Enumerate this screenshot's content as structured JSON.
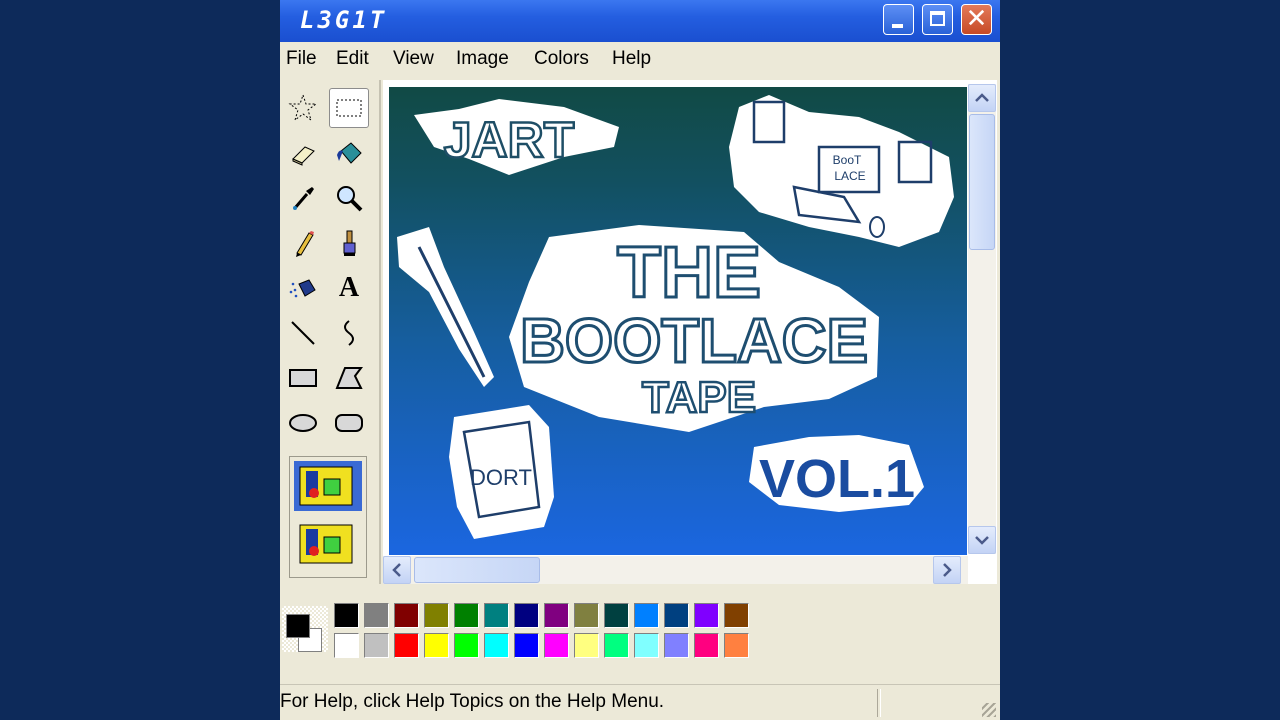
{
  "window": {
    "title": "L3G1T",
    "controls": [
      "minimize",
      "maximize",
      "close"
    ],
    "close_glyph": "✕"
  },
  "menu": {
    "items": [
      "File",
      "Edit",
      "View",
      "Image",
      "Colors",
      "Help"
    ]
  },
  "toolbox": {
    "tools": [
      {
        "name": "free-form-select-icon"
      },
      {
        "name": "rect-select-icon",
        "selected": true
      },
      {
        "name": "eraser-icon"
      },
      {
        "name": "fill-bucket-icon"
      },
      {
        "name": "color-picker-icon"
      },
      {
        "name": "magnifier-icon"
      },
      {
        "name": "pencil-icon"
      },
      {
        "name": "brush-icon"
      },
      {
        "name": "airbrush-icon"
      },
      {
        "name": "text-icon",
        "glyph": "A"
      },
      {
        "name": "line-icon"
      },
      {
        "name": "curve-icon"
      },
      {
        "name": "rectangle-icon"
      },
      {
        "name": "polygon-icon"
      },
      {
        "name": "ellipse-icon"
      },
      {
        "name": "rounded-rect-icon"
      }
    ]
  },
  "artwork": {
    "texts": [
      "JART",
      "THE",
      "BOOTLACE",
      "TAPE",
      "VOL.1",
      "DORT",
      "BooT",
      "LACE"
    ]
  },
  "palette": {
    "foreground": "#000000",
    "background": "#ffffff",
    "row1": [
      "#000000",
      "#808080",
      "#800000",
      "#808000",
      "#008000",
      "#008080",
      "#000080",
      "#800080",
      "#808040",
      "#004040",
      "#0080ff",
      "#004080",
      "#8000ff",
      "#804000"
    ],
    "row2": [
      "#ffffff",
      "#c0c0c0",
      "#ff0000",
      "#ffff00",
      "#00ff00",
      "#00ffff",
      "#0000ff",
      "#ff00ff",
      "#ffff80",
      "#00ff80",
      "#80ffff",
      "#8080ff",
      "#ff0080",
      "#ff8040"
    ]
  },
  "status": {
    "text": "For Help, click Help Topics on the Help Menu."
  }
}
